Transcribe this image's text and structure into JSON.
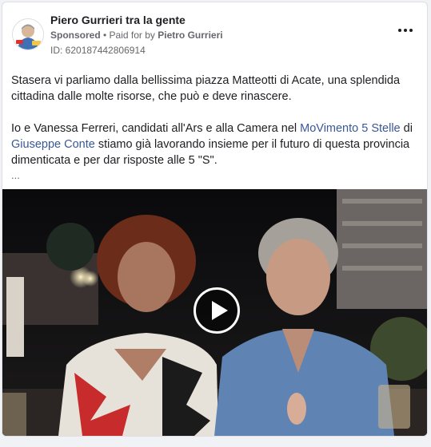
{
  "post": {
    "page_name": "Piero Gurrieri tra la gente",
    "sponsored_label": "Sponsored",
    "separator": " • ",
    "paid_for_prefix": "Paid for by ",
    "payer_name": "Pietro Gurrieri",
    "ad_id": "ID: 620187442806914"
  },
  "body": {
    "paragraph1": "Stasera vi parliamo dalla bellissima piazza Matteotti di Acate, una splendida cittadina dalle molte risorse, che può e deve rinascere.",
    "p2_part1": "Io e Vanessa Ferreri, candidati all'Ars e alla Camera nel ",
    "p2_link1": "MoVimento 5 Stelle",
    "p2_part2": " di ",
    "p2_link2": "Giuseppe Conte",
    "p2_part3": " stiamo già lavorando insieme per il futuro di questa provincia dimenticata e per dar risposte alle 5 \"S\".",
    "ellipsis": "..."
  },
  "video": {
    "play_icon": "play-icon"
  },
  "icons": {
    "more": "more-options-icon",
    "avatar": "avatar"
  },
  "colors": {
    "link": "#385898",
    "secondary_text": "#65676b"
  }
}
